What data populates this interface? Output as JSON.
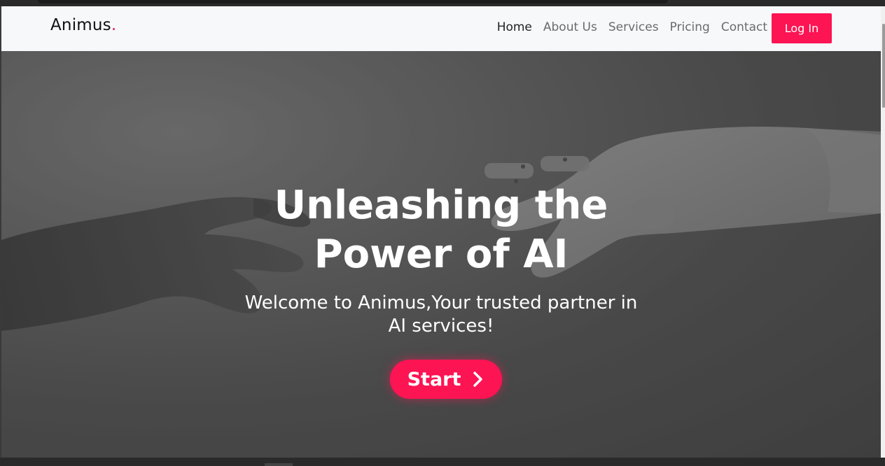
{
  "navbar": {
    "brand": "Animus",
    "brand_dot": ".",
    "links": [
      {
        "label": "Home",
        "active": true
      },
      {
        "label": "About Us",
        "active": false
      },
      {
        "label": "Services",
        "active": false
      },
      {
        "label": "Pricing",
        "active": false
      },
      {
        "label": "Contact",
        "active": false
      }
    ],
    "login_label": "Log In"
  },
  "hero": {
    "title_line1": "Unleashing the",
    "title_line2": "Power of AI",
    "subtitle_line1": "Welcome to Animus,Your trusted partner in",
    "subtitle_line2": "AI services!",
    "start_label": "Start"
  },
  "colors": {
    "accent": "#fd1453",
    "brand_dot": "#e0174f"
  }
}
